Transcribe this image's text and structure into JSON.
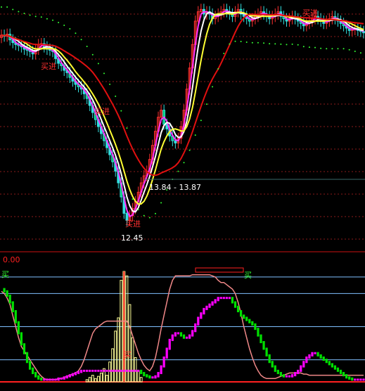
{
  "colors": {
    "background": "#000000",
    "grid": "#8b1a1a",
    "up_candle": "#ff3030",
    "down_candle": "#33e0e0",
    "down_candle_fill": "#00cc66",
    "ma_white": "#ffffff",
    "ma_yellow": "#ffff33",
    "ma_magenta": "#ff33ff",
    "ma_red": "#e01010",
    "ma_dots": "#33ff33",
    "buy_text": "#ff3030",
    "separator": "#cc1010",
    "indicator_zero": "#ff2020",
    "indicator_line": "#f08888",
    "indicator_green": "#00e000",
    "indicator_magenta": "#ff00ff",
    "level_lines": "#80c0ff",
    "volume_bars": "#ffff99"
  },
  "chart_data": [
    {
      "type": "candlestick",
      "title": "",
      "annotations": {
        "buy_labels": [
          "买进",
          "买进",
          "买进",
          "买进"
        ],
        "range_label": "13.84 - 13.87",
        "low_label": "12.45"
      },
      "ylim": [
        12.1,
        17.2
      ],
      "x": [
        1,
        2,
        3,
        4,
        5,
        6,
        7,
        8,
        9,
        10,
        11,
        12,
        13,
        14,
        15,
        16,
        17,
        18,
        19,
        20,
        21,
        22,
        23,
        24,
        25,
        26,
        27,
        28,
        29,
        30,
        31,
        32,
        33,
        34,
        35,
        36,
        37,
        38,
        39,
        40,
        41,
        42,
        43,
        44,
        45,
        46,
        47,
        48,
        49,
        50,
        51,
        52,
        53,
        54,
        55,
        56,
        57,
        58,
        59,
        60,
        61,
        62,
        63,
        64,
        65,
        66,
        67,
        68,
        69,
        70,
        71,
        72,
        73,
        74,
        75,
        76,
        77,
        78,
        79,
        80,
        81,
        82,
        83,
        84,
        85,
        86,
        87,
        88,
        89,
        90,
        91,
        92,
        93,
        94,
        95,
        96,
        97,
        98,
        99,
        100,
        101,
        102,
        103,
        104,
        105,
        106,
        107,
        108,
        109,
        110,
        111,
        112,
        113,
        114,
        115,
        116,
        117,
        118,
        119,
        120,
        121,
        122,
        123,
        124,
        125,
        126,
        127,
        128
      ],
      "open": [
        16.55,
        16.6,
        16.58,
        16.62,
        16.5,
        16.44,
        16.4,
        16.38,
        16.35,
        16.3,
        16.28,
        16.25,
        16.2,
        16.3,
        16.4,
        16.42,
        16.35,
        16.3,
        16.28,
        16.25,
        16.1,
        16.0,
        15.95,
        15.85,
        15.8,
        15.7,
        15.62,
        15.55,
        15.5,
        15.45,
        15.35,
        15.25,
        15.1,
        14.95,
        14.8,
        14.65,
        14.5,
        14.35,
        14.2,
        14.05,
        13.9,
        13.7,
        13.45,
        13.15,
        12.8,
        12.65,
        12.75,
        12.9,
        13.05,
        13.25,
        13.45,
        13.6,
        13.7,
        13.95,
        14.25,
        14.55,
        14.85,
        15.0,
        14.7,
        14.6,
        14.45,
        14.35,
        14.3,
        14.4,
        14.65,
        15.0,
        15.45,
        15.9,
        16.4,
        16.9,
        17.1,
        17.15,
        17.05,
        17.1,
        17.05,
        16.95,
        17.0,
        17.05,
        17.1,
        17.15,
        17.1,
        17.05,
        17.0,
        17.1,
        17.15,
        17.05,
        17.0,
        16.95,
        16.9,
        16.95,
        17.0,
        17.05,
        17.1,
        17.05,
        17.0,
        16.95,
        17.0,
        17.05,
        17.1,
        17.0,
        16.95,
        16.9,
        16.95,
        17.0,
        16.95,
        16.9,
        16.85,
        16.8,
        16.85,
        16.9,
        16.95,
        17.0,
        16.95,
        16.9,
        16.85,
        16.9,
        16.95,
        17.0,
        16.95,
        16.9,
        16.85,
        16.8,
        16.75,
        16.7,
        16.72,
        16.75,
        16.7,
        16.68
      ],
      "close": [
        16.6,
        16.58,
        16.62,
        16.5,
        16.44,
        16.4,
        16.38,
        16.35,
        16.3,
        16.28,
        16.25,
        16.2,
        16.3,
        16.4,
        16.42,
        16.35,
        16.3,
        16.28,
        16.25,
        16.1,
        16.0,
        15.95,
        15.85,
        15.8,
        15.7,
        15.62,
        15.55,
        15.5,
        15.45,
        15.35,
        15.25,
        15.1,
        14.95,
        14.8,
        14.65,
        14.5,
        14.35,
        14.2,
        14.05,
        13.9,
        13.7,
        13.45,
        13.15,
        12.8,
        12.65,
        12.75,
        12.9,
        13.05,
        13.25,
        13.45,
        13.6,
        13.7,
        13.95,
        14.25,
        14.55,
        14.85,
        15.0,
        14.7,
        14.6,
        14.45,
        14.35,
        14.3,
        14.4,
        14.65,
        15.0,
        15.45,
        15.9,
        16.4,
        16.9,
        17.1,
        17.15,
        17.05,
        17.1,
        17.05,
        16.95,
        17.0,
        17.05,
        17.1,
        17.15,
        17.1,
        17.05,
        17.0,
        17.1,
        17.15,
        17.05,
        17.0,
        16.95,
        16.9,
        16.95,
        17.0,
        17.05,
        17.1,
        17.05,
        17.0,
        16.95,
        17.0,
        17.05,
        17.1,
        17.0,
        16.95,
        16.9,
        16.95,
        17.0,
        16.95,
        16.9,
        16.85,
        16.8,
        16.85,
        16.9,
        16.95,
        17.0,
        16.95,
        16.9,
        16.85,
        16.9,
        16.95,
        17.0,
        16.95,
        16.9,
        16.85,
        16.8,
        16.75,
        16.7,
        16.72,
        16.75,
        16.7,
        16.68,
        16.65
      ]
    },
    {
      "type": "line",
      "title": "",
      "header_value": "0.00",
      "buy_labels": [
        "买",
        "买",
        "买"
      ],
      "ylim": [
        0,
        100
      ],
      "levels": [
        20,
        50,
        80,
        95
      ],
      "series": [
        {
          "values": [
            82,
            80,
            76,
            70,
            60,
            50,
            40,
            32,
            28,
            24,
            20,
            16,
            12,
            8,
            5,
            3,
            2,
            2,
            2,
            2,
            3,
            3,
            4,
            5,
            6,
            7,
            8,
            10,
            14,
            20,
            28,
            36,
            44,
            48,
            50,
            52,
            54,
            55,
            55,
            55,
            55,
            55,
            55,
            55,
            55,
            50,
            42,
            34,
            26,
            20,
            15,
            12,
            10,
            14,
            22,
            34,
            48,
            60,
            72,
            84,
            92,
            96,
            96,
            96,
            96,
            96,
            96,
            97,
            97,
            97,
            97,
            97,
            97,
            97,
            96,
            95,
            92,
            90,
            90,
            88,
            86,
            84,
            80,
            72,
            62,
            50,
            40,
            30,
            22,
            15,
            10,
            6,
            4,
            3,
            3,
            3,
            3,
            4,
            5,
            6,
            7,
            8,
            8,
            8,
            8,
            8,
            7,
            7,
            6,
            6,
            6,
            6,
            6,
            6,
            6,
            6,
            6,
            6,
            6,
            6,
            6,
            6,
            6,
            6,
            6,
            6,
            6,
            6
          ]
        },
        {
          "values": [
            84,
            82,
            78,
            72,
            64,
            54,
            44,
            34,
            26,
            18,
            12,
            8,
            5,
            3,
            2,
            2,
            2,
            2,
            2,
            2,
            3,
            3,
            4,
            5,
            6,
            7,
            8,
            9,
            10,
            10,
            10,
            10,
            10,
            10,
            10,
            10,
            10,
            10,
            10,
            10,
            10,
            10,
            10,
            10,
            10,
            10,
            10,
            10,
            10,
            8,
            6,
            5,
            4,
            4,
            5,
            8,
            14,
            22,
            30,
            38,
            42,
            44,
            44,
            42,
            40,
            40,
            42,
            46,
            52,
            58,
            62,
            66,
            68,
            70,
            72,
            74,
            76,
            76,
            76,
            76,
            76,
            72,
            68,
            64,
            60,
            58,
            56,
            54,
            52,
            48,
            42,
            36,
            30,
            24,
            18,
            14,
            10,
            8,
            6,
            5,
            5,
            5,
            6,
            8,
            10,
            14,
            18,
            22,
            24,
            26,
            26,
            24,
            22,
            20,
            18,
            16,
            14,
            12,
            10,
            8,
            6,
            4,
            3,
            2,
            2,
            2,
            2,
            2
          ]
        }
      ],
      "volume_bars": [
        0,
        0,
        0,
        0,
        0,
        0,
        0,
        0,
        0,
        0,
        0,
        0,
        0,
        0,
        0,
        0,
        0,
        0,
        0,
        0,
        0,
        0,
        0,
        0,
        0,
        0,
        0,
        0,
        0,
        0,
        2,
        4,
        6,
        3,
        5,
        8,
        12,
        6,
        18,
        30,
        46,
        58,
        92,
        100,
        96,
        70,
        40,
        22,
        10,
        4,
        0,
        0,
        0,
        0,
        0,
        0,
        0,
        0,
        0,
        0,
        0,
        0,
        0,
        0,
        0,
        0,
        0,
        0,
        0,
        0,
        0,
        0,
        0,
        0,
        0,
        0,
        0,
        0,
        0,
        0,
        0,
        0,
        0,
        0,
        0,
        0,
        0,
        0,
        0,
        0,
        0,
        0,
        0,
        0,
        0,
        0,
        0,
        0,
        0,
        0,
        0,
        0,
        0,
        0,
        0,
        0,
        0,
        0,
        0,
        0,
        0,
        0,
        0,
        0,
        0,
        0,
        0,
        0,
        0,
        0,
        0,
        0,
        0,
        0,
        0,
        0,
        0,
        0
      ]
    }
  ]
}
